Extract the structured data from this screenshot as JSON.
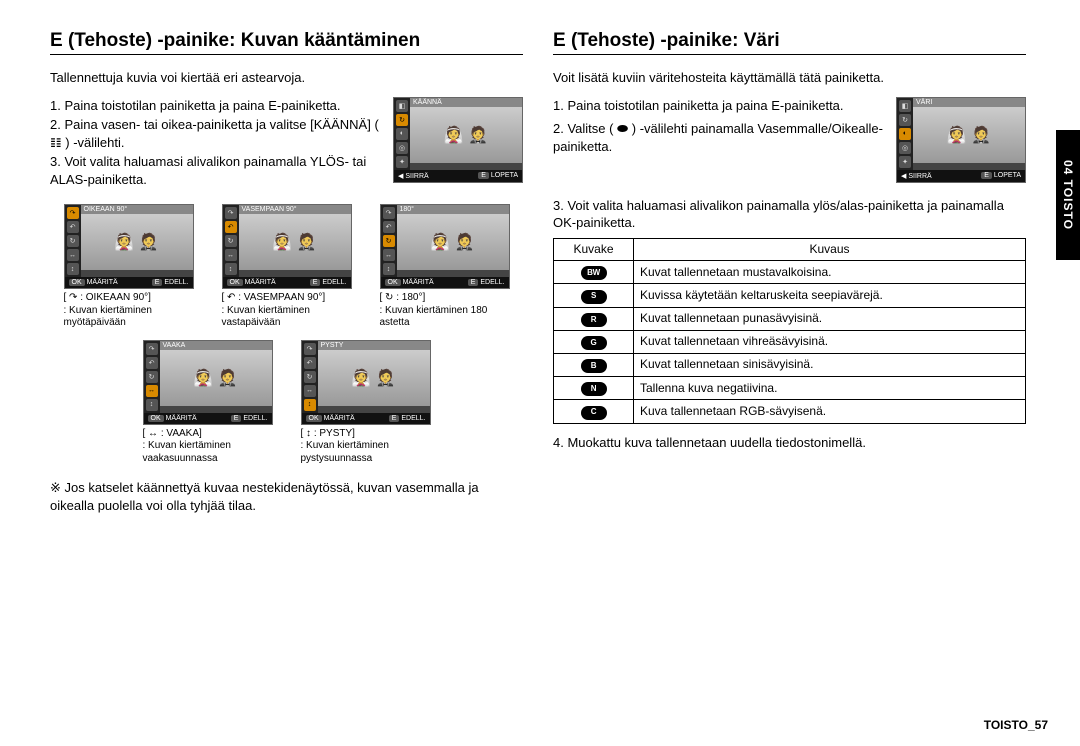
{
  "left": {
    "title": "E (Tehoste) -painike: Kuvan kääntäminen",
    "intro": "Tallennettuja kuvia voi kiertää eri astearvoja.",
    "steps": [
      "1. Paina toistotilan painiketta ja paina E-painiketta.",
      "2. Paina vasen- tai oikea-painiketta ja valitse [KÄÄNNÄ] ( 𝌮 ) -välilehti.",
      "3. Voit valita haluamasi alivalikon painamalla YLÖS- tai ALAS-painiketta."
    ],
    "lcd_main": {
      "label": "KÄÄNNÄ",
      "bottom_left": "◀ SIIRRÄ",
      "bottom_right": "E  LOPETA"
    },
    "thumbs": [
      {
        "label": "OIKEAAN 90°",
        "caption1": "[ ↷ : OIKEAAN  90°]",
        "caption2": ": Kuvan kiertäminen myötäpäivään",
        "bottom_ok": "OK  MÄÄRITÄ",
        "bottom_right": "E  EDELL."
      },
      {
        "label": "VASEMPAAN 90°",
        "caption1": "[ ↶ : VASEMPAAN 90°]",
        "caption2": ": Kuvan kiertäminen vastapäivään",
        "bottom_ok": "OK  MÄÄRITÄ",
        "bottom_right": "E  EDELL."
      },
      {
        "label": "180°",
        "caption1": "[ ↻ :  180°]",
        "caption2": ": Kuvan kiertäminen 180 astetta",
        "bottom_ok": "OK  MÄÄRITÄ",
        "bottom_right": "E  EDELL."
      },
      {
        "label": "VAAKA",
        "caption1": "[ ↔ :  VAAKA]",
        "caption2": ": Kuvan kiertäminen vaakasuunnassa",
        "bottom_ok": "OK  MÄÄRITÄ",
        "bottom_right": "E  EDELL."
      },
      {
        "label": "PYSTY",
        "caption1": "[ ↕ :  PYSTY]",
        "caption2": ": Kuvan kiertäminen pystysuunnassa",
        "bottom_ok": "OK  MÄÄRITÄ",
        "bottom_right": "E  EDELL."
      }
    ],
    "note": "※ Jos katselet käännettyä kuvaa nestekidenäytössä, kuvan vasemmalla ja oikealla puolella voi olla tyhjää tilaa."
  },
  "right": {
    "title": "E (Tehoste) -painike: Väri",
    "intro": "Voit lisätä kuviin väritehosteita käyttämällä tätä painiketta.",
    "steps_top": [
      "1. Paina toistotilan painiketta ja paina E-painiketta.",
      "2. Valitse ( ⬬ ) -välilehti painamalla Vasemmalle/Oikealle-painiketta."
    ],
    "lcd_color": {
      "label": "VÄRI",
      "bottom_left": "◀ SIIRRÄ",
      "bottom_right": "E  LOPETA"
    },
    "step3": "3. Voit valita haluamasi alivalikon painamalla ylös/alas-painiketta ja painamalla OK-painiketta.",
    "table": {
      "head": [
        "Kuvake",
        "Kuvaus"
      ],
      "rows": [
        {
          "icon": "BW",
          "desc": "Kuvat tallennetaan mustavalkoisina."
        },
        {
          "icon": "S",
          "desc": "Kuvissa käytetään keltaruskeita seepiavärejä."
        },
        {
          "icon": "R",
          "desc": "Kuvat tallennetaan punasävyisinä."
        },
        {
          "icon": "G",
          "desc": "Kuvat tallennetaan vihreäsävyisinä."
        },
        {
          "icon": "B",
          "desc": "Kuvat tallennetaan sinisävyisinä."
        },
        {
          "icon": "N",
          "desc": "Tallenna kuva negatiivina."
        },
        {
          "icon": "C",
          "desc": "Kuva tallennetaan RGB-sävyisenä."
        }
      ]
    },
    "step4": "4. Muokattu kuva tallennetaan uudella tiedostonimellä."
  },
  "side_tab": "04 TOISTO",
  "footer": "TOISTO_57"
}
